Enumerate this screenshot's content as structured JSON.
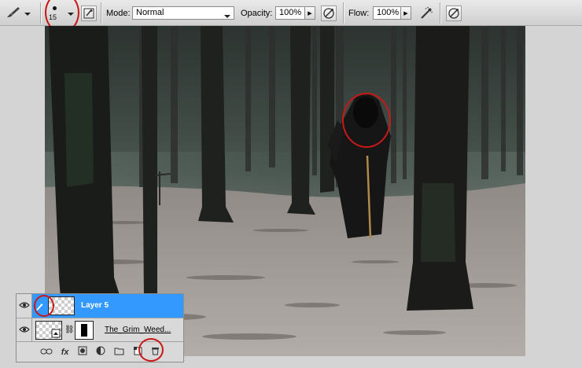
{
  "toolbar": {
    "brush_size": "15",
    "mode_label": "Mode:",
    "mode_value": "Normal",
    "opacity_label": "Opacity:",
    "opacity_value": "100%",
    "flow_label": "Flow:",
    "flow_value": "100%"
  },
  "icons": {
    "brush_tool": "brush-icon",
    "brush_preset": "brush-preset-icon",
    "brush_panel": "brush-panel-toggle-icon",
    "opacity_pressure": "tablet-pressure-opacity-icon",
    "airbrush": "airbrush-icon",
    "size_pressure": "tablet-pressure-size-icon"
  },
  "layers_panel": {
    "layers": [
      {
        "name": "Layer 5",
        "selected": true
      },
      {
        "name": "The_Grim_Weed...",
        "selected": false
      }
    ],
    "bottom_buttons": [
      "link-layers-icon",
      "fx-icon",
      "add-mask-icon",
      "adjustment-layer-icon",
      "new-group-icon",
      "new-layer-icon",
      "delete-layer-icon"
    ],
    "fx_label": "fx"
  },
  "colors": {
    "selection": "#3399ff",
    "annotation_red": "#c81818",
    "toolbar_bg": "#d8d8d8"
  }
}
